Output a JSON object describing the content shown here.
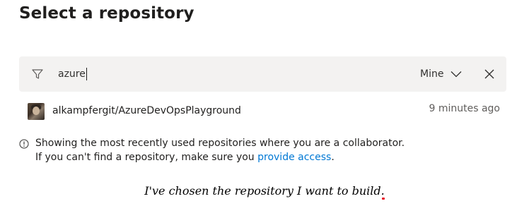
{
  "header": {
    "title": "Select a repository"
  },
  "filter": {
    "value": "azure",
    "scope_label": "Mine"
  },
  "repositories": [
    {
      "name": "alkampfergit/AzureDevOpsPlayground",
      "time": "9 minutes ago"
    }
  ],
  "info": {
    "line1": "Showing the most recently used repositories where you are a collaborator.",
    "line2_prefix": "If you can't find a repository, make sure you ",
    "line2_link": "provide access",
    "line2_suffix": "."
  },
  "caption": {
    "text": "I've chosen the repository I want to build",
    "period": "."
  },
  "colors": {
    "link": "#0078d4",
    "filter_bg": "#f3f2f1",
    "secondary_text": "#605e5c"
  },
  "icons": {
    "filter": "filter-funnel-icon",
    "scope": "chevron-down-icon",
    "close": "close-icon",
    "info": "info-icon"
  }
}
